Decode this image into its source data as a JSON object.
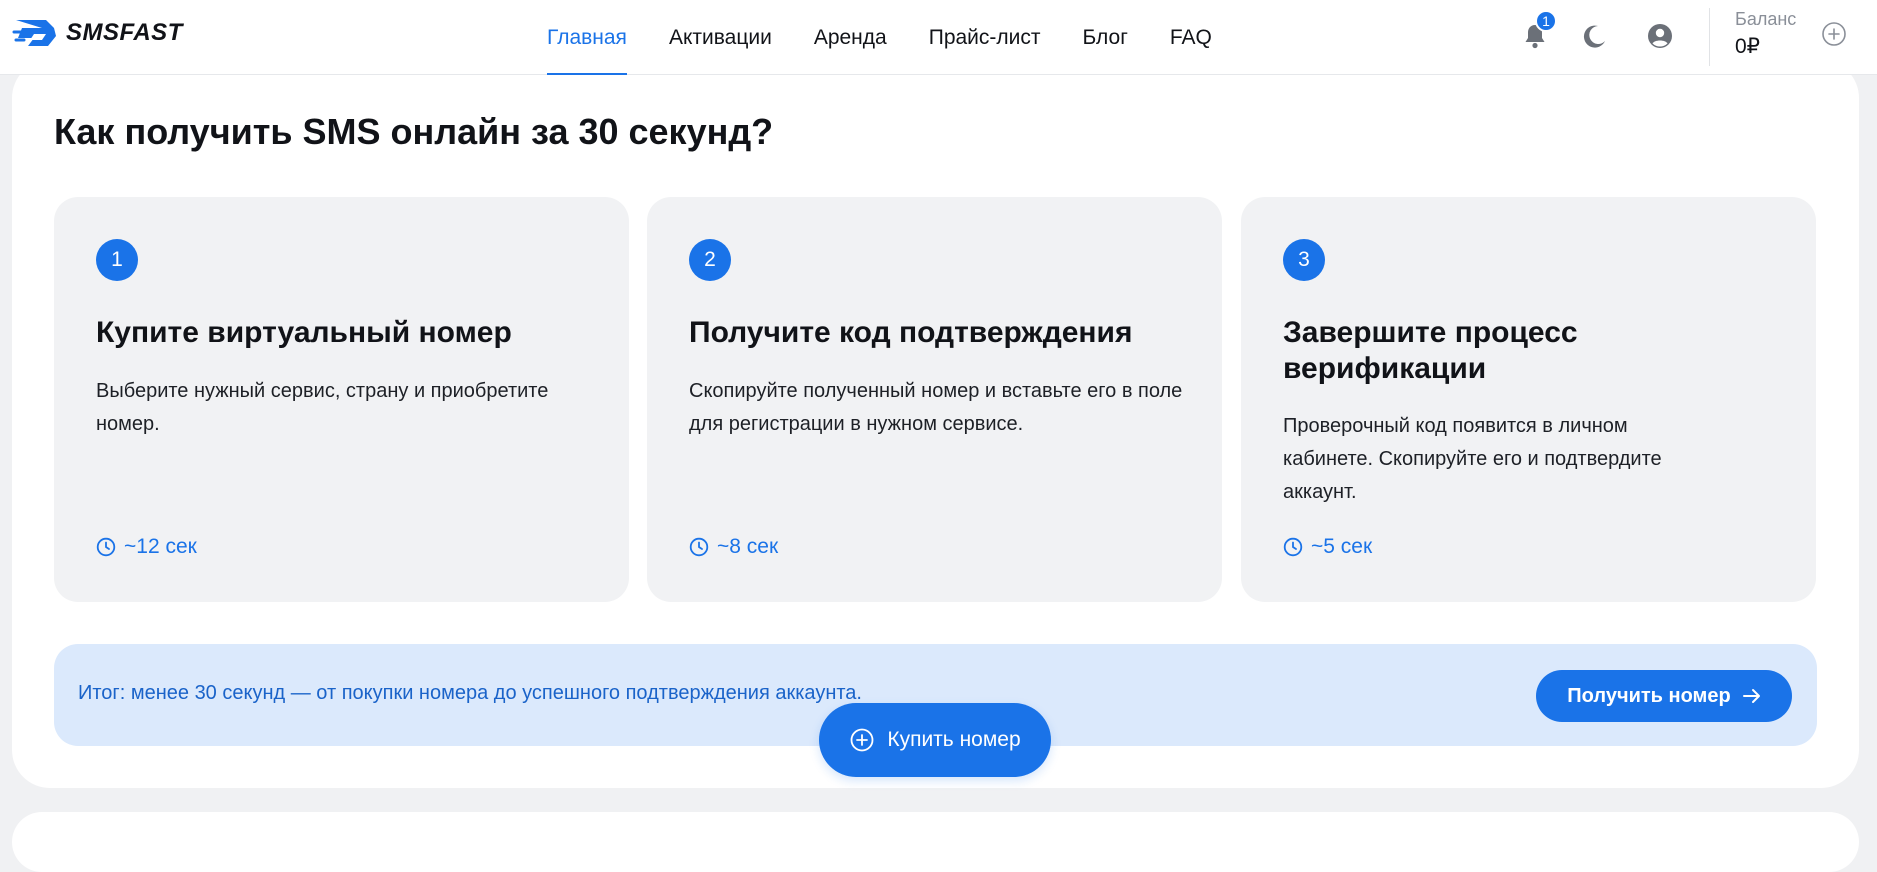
{
  "header": {
    "logo_text": "SMSFAST",
    "nav": [
      {
        "label": "Главная",
        "active": true
      },
      {
        "label": "Активации",
        "active": false
      },
      {
        "label": "Аренда",
        "active": false
      },
      {
        "label": "Прайс-лист",
        "active": false
      },
      {
        "label": "Блог",
        "active": false
      },
      {
        "label": "FAQ",
        "active": false
      }
    ],
    "notification_count": "1",
    "balance_label": "Баланс",
    "balance_value": "0₽"
  },
  "main": {
    "title": "Как получить SMS онлайн за 30 секунд?",
    "steps": [
      {
        "number": "1",
        "title": "Купите виртуальный номер",
        "description": "Выберите нужный сервис, страну и приобретите номер.",
        "time": "~12 сек"
      },
      {
        "number": "2",
        "title": "Получите код подтверждения",
        "description": "Скопируйте полученный номер и вставьте его в поле для регистрации в нужном сервисе.",
        "time": "~8 сек"
      },
      {
        "number": "3",
        "title": "Завершите процесс верификации",
        "description": "Проверочный код появится в личном кабинете. Скопируйте его и подтвердите аккаунт.",
        "time": "~5 сек"
      }
    ],
    "summary_text": "Итог: менее 30 секунд — от покупки номера до успешного подтверждения аккаунта.",
    "get_number_label": "Получить номер",
    "buy_number_label": "Купить номер"
  },
  "colors": {
    "accent": "#1a73e8",
    "card_bg": "#f1f2f4",
    "summary_bg": "#dbe9fc",
    "page_bg": "#f0f1f3"
  },
  "icons": {
    "logo": "smsfast-logo-icon",
    "bell": "bell-icon",
    "moon": "moon-icon",
    "user": "user-icon",
    "add": "plus-circle-icon",
    "clock": "clock-icon",
    "arrow": "arrow-right-icon"
  }
}
